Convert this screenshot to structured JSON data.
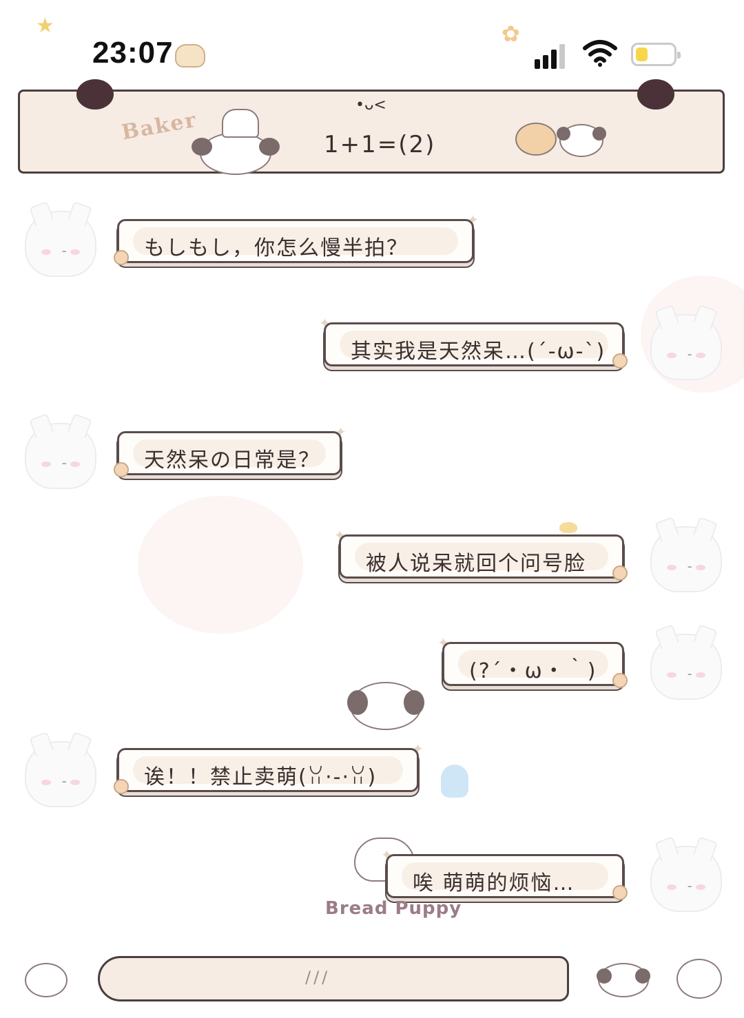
{
  "status_bar": {
    "time": "23:07",
    "battery_level": 0.3
  },
  "header": {
    "brand_text": "Baker",
    "chat_title": "1+1=(2)",
    "chat_subtitle": "•ᴗ<"
  },
  "messages": [
    {
      "side": "left",
      "text": "もしもし，你怎么慢半拍？"
    },
    {
      "side": "right",
      "text": "其实我是天然呆…(´-ω-`)"
    },
    {
      "side": "left",
      "text": "天然呆の日常是？"
    },
    {
      "side": "right",
      "text": "被人说呆就回个问号脸"
    },
    {
      "side": "right",
      "text": "(?´・ω・｀)"
    },
    {
      "side": "left",
      "text": "诶！！禁止卖萌(ꃋ·-·ꃋ)"
    },
    {
      "side": "right",
      "text": "唉 萌萌的烦恼…"
    }
  ],
  "sticker_brand": "Bread Puppy",
  "input": {
    "placeholder": "///"
  },
  "icons": [
    "star-icon",
    "flower-icon",
    "signal-icon",
    "wifi-icon",
    "battery-icon",
    "cat-avatar-icon",
    "puppy-icon"
  ]
}
